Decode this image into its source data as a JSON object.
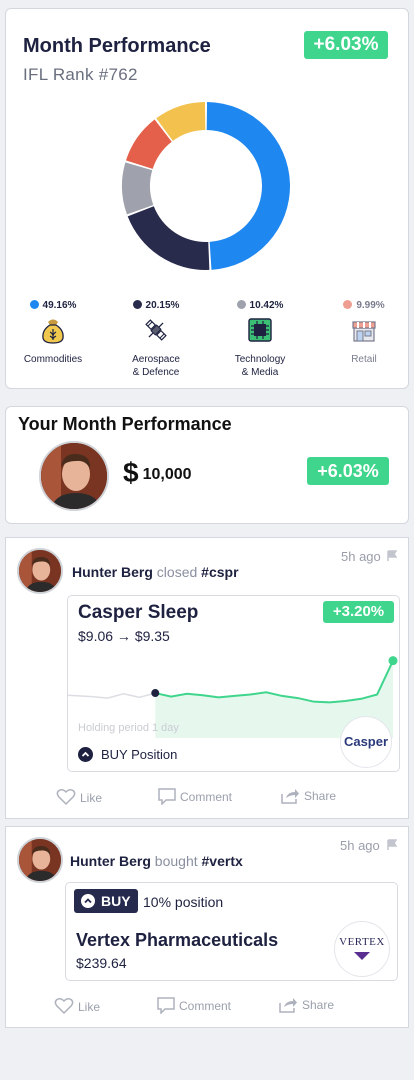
{
  "month_performance": {
    "title": "Month Performance",
    "rank": "IFL Rank #762",
    "change": "+6.03%",
    "chart_data": {
      "type": "pie",
      "slices": [
        {
          "label": "Commodities",
          "value": 49.16,
          "color": "#1e87f0"
        },
        {
          "label": "Aerospace & Defence",
          "value": 20.15,
          "color": "#292b4d"
        },
        {
          "label": "Technology & Media",
          "value": 10.42,
          "color": "#9fa1ad"
        },
        {
          "label": "Retail",
          "value": 9.99,
          "color": "#e5604a"
        },
        {
          "label": "",
          "value": 10.28,
          "color": "#f2c14e"
        }
      ]
    },
    "legend": [
      {
        "pct": "49.16%",
        "line1": "Commodities",
        "line2": "",
        "color": "#1e87f0",
        "icon": "commodities-icon"
      },
      {
        "pct": "20.15%",
        "line1": "Aerospace",
        "line2": "& Defence",
        "color": "#292b4d",
        "icon": "satellite-icon"
      },
      {
        "pct": "10.42%",
        "line1": "Technology",
        "line2": "& Media",
        "color": "#9fa1ad",
        "icon": "chip-icon"
      },
      {
        "pct": "9.99%",
        "line1": "Retail",
        "line2": "",
        "color": "#e5604a",
        "icon": "store-icon"
      }
    ]
  },
  "your_performance": {
    "title": "Your Month Performance",
    "currency": "$",
    "amount": "10,000",
    "change": "+6.03%"
  },
  "feed": [
    {
      "user": "Hunter Berg",
      "verb": "closed",
      "tag": "#cspr",
      "time": "5h ago",
      "stock": "Casper Sleep",
      "price": "$9.06 → $9.35",
      "change": "+3.20%",
      "holding": "Holding period 1 day",
      "position": "BUY Position",
      "logo": "Casper",
      "spark": [
        42,
        47,
        40,
        44,
        41,
        43,
        38,
        42,
        40,
        37,
        39,
        41,
        44,
        39,
        36,
        31,
        30,
        32,
        35,
        41,
        88
      ]
    },
    {
      "user": "Hunter Berg",
      "verb": "bought",
      "tag": "#vertx",
      "time": "5h ago",
      "badge": "BUY",
      "position": "10% position",
      "stock": "Vertex Pharmaceuticals",
      "price": "$239.64",
      "logo": "VERTEX"
    }
  ],
  "actions": {
    "like": "Like",
    "comment": "Comment",
    "share": "Share"
  }
}
